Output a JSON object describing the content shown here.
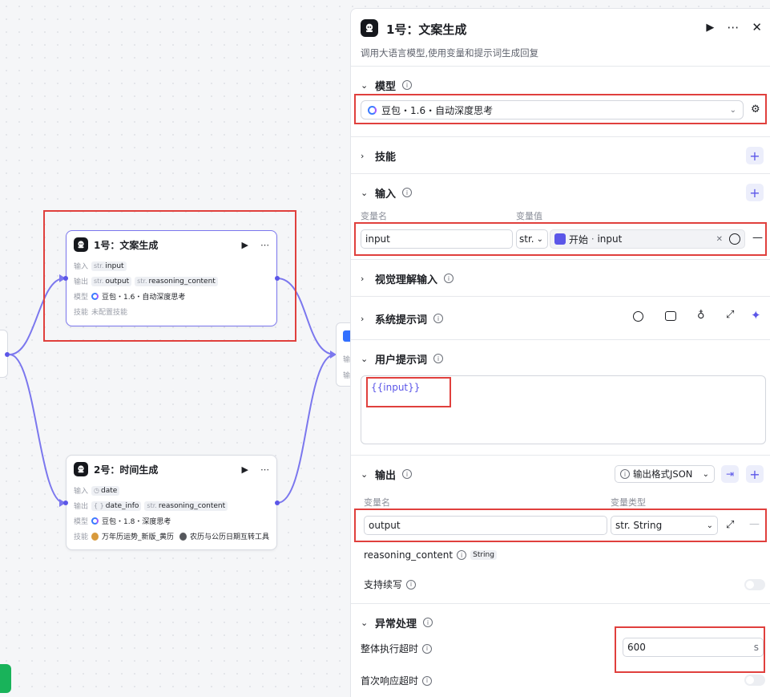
{
  "canvas": {
    "node1": {
      "title": "1号：文案生成",
      "rows": {
        "input_label": "输入",
        "input_tags": [
          {
            "type": "str.",
            "name": "input"
          }
        ],
        "output_label": "输出",
        "output_tags": [
          {
            "type": "str.",
            "name": "output"
          },
          {
            "type": "str.",
            "name": "reasoning_content"
          }
        ],
        "model_label": "模型",
        "model_value": "豆包・1.6・自动深度思考",
        "skill_label": "技能",
        "skill_value": "未配置技能"
      }
    },
    "node2": {
      "title": "2号：时间生成",
      "rows": {
        "input_label": "输入",
        "input_tags": [
          {
            "type": "",
            "name": "date"
          }
        ],
        "output_label": "输出",
        "output_tags": [
          {
            "type": "{ }",
            "name": "date_info"
          },
          {
            "type": "str.",
            "name": "reasoning_content"
          }
        ],
        "model_label": "模型",
        "model_value": "豆包・1.8・深度思考",
        "skill_label": "技能",
        "skills": [
          "万年历运势_新版_黄历",
          "农历与公历日期互转工具"
        ]
      }
    },
    "partial_node_labels": [
      "输",
      "输"
    ]
  },
  "panel": {
    "title": "1号：文案生成",
    "description": "调用大语言模型,使用变量和提示词生成回复",
    "sections": {
      "model": {
        "title": "模型",
        "selected": "豆包・1.6・自动深度思考"
      },
      "skills": {
        "title": "技能"
      },
      "input": {
        "title": "输入",
        "col_name": "变量名",
        "col_value": "变量值",
        "row": {
          "name": "input",
          "type": "str.",
          "ref_source": "开始",
          "ref_sep": " · ",
          "ref_var": "input"
        }
      },
      "vision": {
        "title": "视觉理解输入"
      },
      "system_prompt": {
        "title": "系统提示词"
      },
      "user_prompt": {
        "title": "用户提示词",
        "content": "{{input}}"
      },
      "output": {
        "title": "输出",
        "format_button": "输出格式JSON",
        "col_name": "变量名",
        "col_type": "变量类型",
        "row": {
          "name": "output",
          "type": "str. String"
        },
        "reasoning_name": "reasoning_content",
        "reasoning_type": "String",
        "continue_label": "支持续写"
      },
      "exception": {
        "title": "异常处理",
        "timeout_label": "整体执行超时",
        "timeout_value": "600",
        "timeout_unit": "s",
        "first_response_label": "首次响应超时"
      }
    }
  },
  "colors": {
    "accent": "#5b56e8",
    "highlight": "#e0403d",
    "edge": "#7b77ee"
  }
}
